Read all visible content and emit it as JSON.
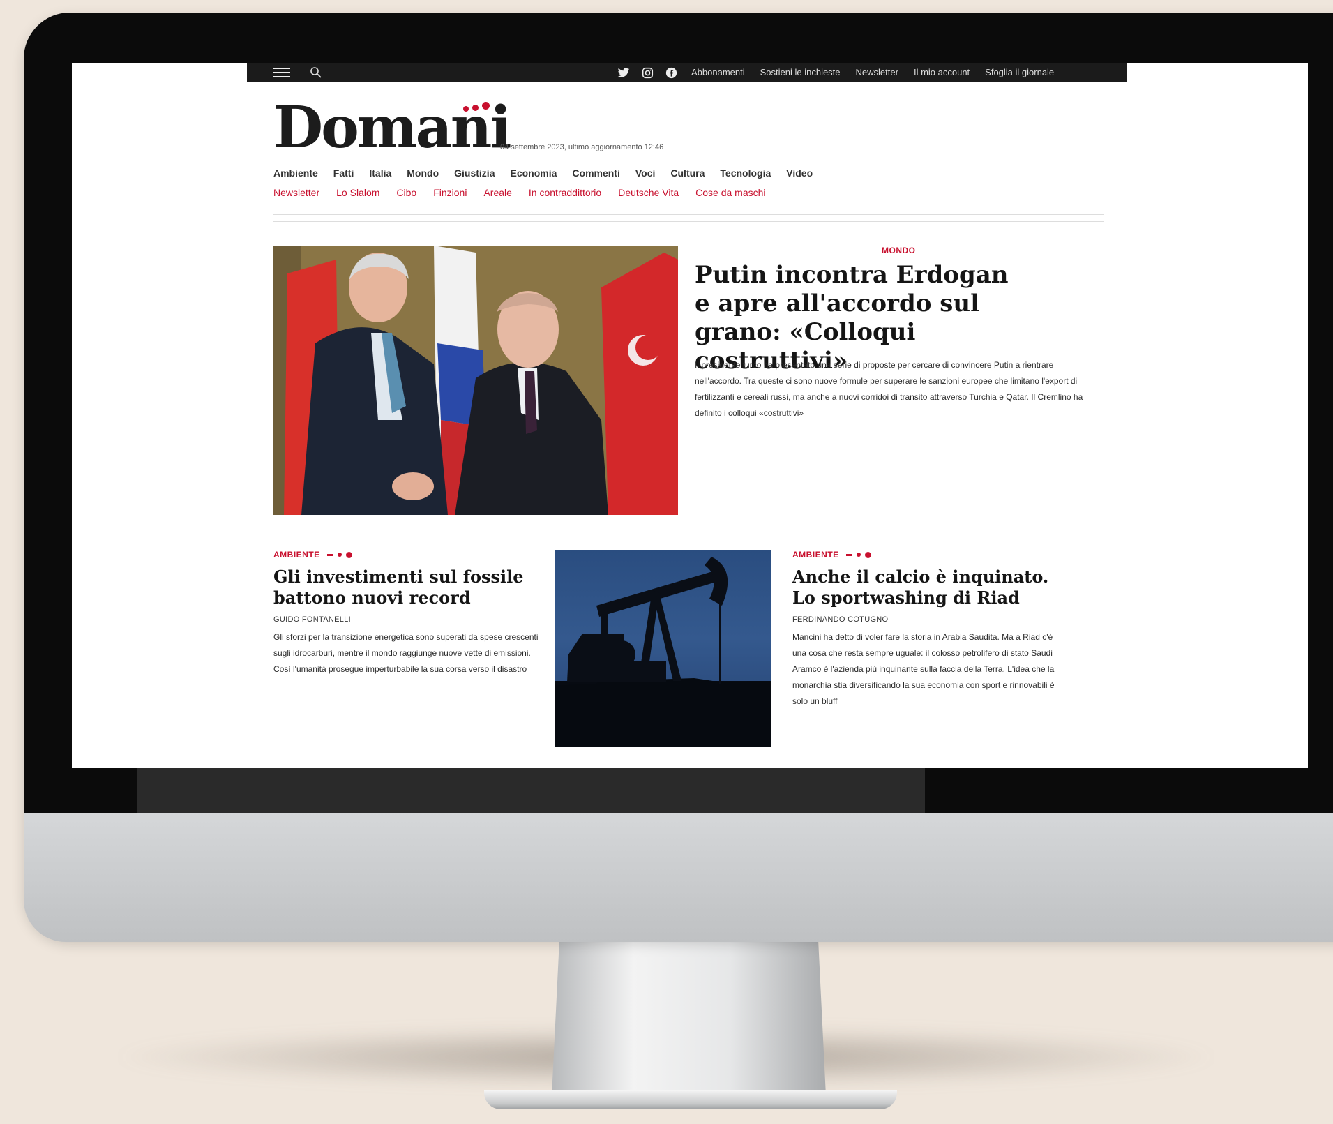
{
  "topbar": {
    "links": [
      "Abbonamenti",
      "Sostieni le inchieste",
      "Newsletter",
      "Il mio account",
      "Sfoglia il giornale"
    ],
    "social_icons": [
      "twitter-icon",
      "instagram-icon",
      "facebook-icon"
    ]
  },
  "masthead": {
    "logo": "Domani",
    "dateline": "04 settembre 2023, ultimo aggiornamento 12:46"
  },
  "nav_primary": [
    "Ambiente",
    "Fatti",
    "Italia",
    "Mondo",
    "Giustizia",
    "Economia",
    "Commenti",
    "Voci",
    "Cultura",
    "Tecnologia",
    "Video"
  ],
  "nav_secondary": [
    "Newsletter",
    "Lo Slalom",
    "Cibo",
    "Finzioni",
    "Areale",
    "In contraddittorio",
    "Deutsche Vita",
    "Cose da maschi"
  ],
  "lead": {
    "kicker": "MONDO",
    "title": "Putin incontra Erdogan e apre all'accordo sul grano: «Colloqui costruttivi»",
    "summary": "Il presidente turco ha presentato una serie di proposte per cercare di convincere Putin a rientrare nell'accordo. Tra queste ci sono nuove formule per superare le sanzioni europee che limitano l'export di fertilizzanti e cereali russi, ma anche a nuovi corridoi di transito attraverso Turchia e Qatar. Il Cremlino ha definito i colloqui «costruttivi»"
  },
  "cards": [
    {
      "kicker": "AMBIENTE",
      "title": "Gli investimenti sul fossile battono nuovi record",
      "author": "GUIDO FONTANELLI",
      "summary": "Gli sforzi per la transizione energetica sono superati da spese crescenti sugli idrocarburi, mentre il mondo raggiunge nuove vette di emissioni. Così l'umanità prosegue imperturbabile la sua corsa verso il disastro"
    },
    {
      "kicker": "AMBIENTE",
      "title": "Anche il calcio è inquinato. Lo sportwashing di Riad",
      "author": "FERDINANDO COTUGNO",
      "summary": "Mancini ha detto di voler fare la storia in Arabia Saudita. Ma a Riad c'è una cosa che resta sempre uguale: il colosso petrolifero di stato Saudi Aramco è l'azienda più inquinante sulla faccia della Terra. L'idea che la monarchia stia diversificando la sua economia con sport e rinnovabili è solo un bluff"
    }
  ],
  "colors": {
    "accent": "#c8102e",
    "topbar": "#1b1b1b",
    "background": "#efe6dc"
  }
}
